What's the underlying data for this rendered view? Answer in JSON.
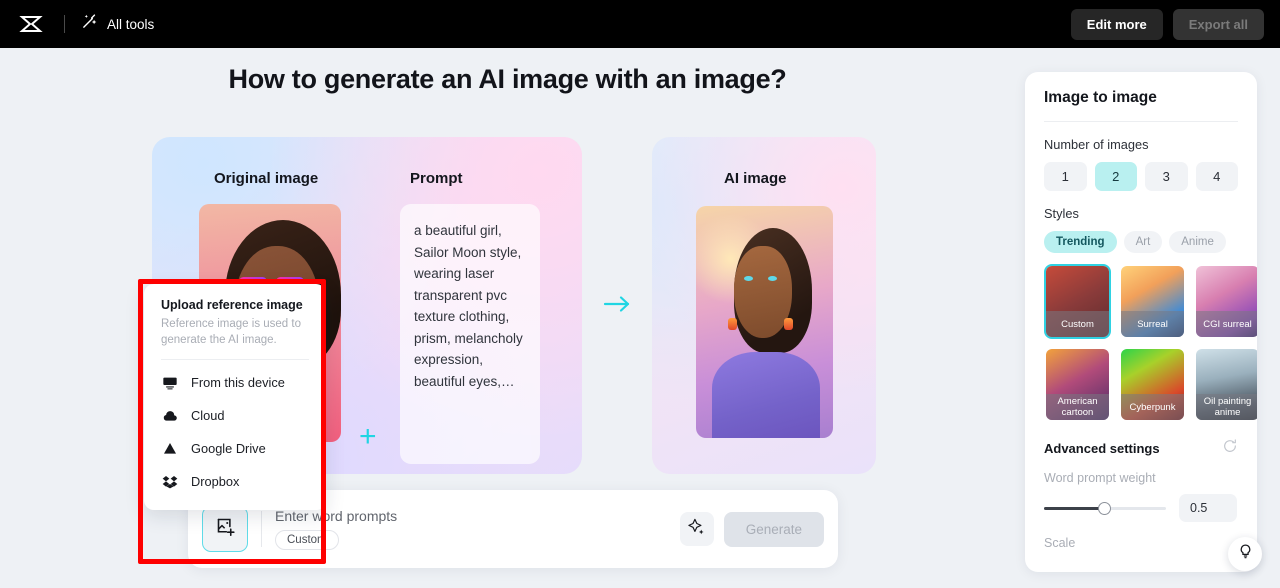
{
  "topbar": {
    "logo_icon": "capcut-logo-icon",
    "alltools_icon": "magic-wand-icon",
    "alltools_label": "All tools",
    "edit_more_label": "Edit more",
    "export_all_label": "Export all"
  },
  "page": {
    "title": "How to generate an AI image with an image?"
  },
  "showcase": {
    "original_heading": "Original image",
    "prompt_heading": "Prompt",
    "ai_heading": "AI image",
    "plus_symbol": "+",
    "arrow_icon": "arrow-right-icon",
    "prompt_text": "a beautiful girl, Sailor Moon style, wearing laser transparent pvc texture clothing, prism, melancholy expression, beautiful eyes,…",
    "accent_cyan": "#20d5e3"
  },
  "bottom_bar": {
    "upload_icon": "add-image-icon",
    "prompt_placeholder": "Enter word prompts",
    "custom_chip_label": "Custom",
    "sparkle_icon": "sparkle-icon",
    "generate_label": "Generate"
  },
  "upload_menu": {
    "title": "Upload reference image",
    "subtitle": "Reference image is used to generate the AI image.",
    "items": [
      {
        "label": "From this device",
        "icon": "monitor-icon"
      },
      {
        "label": "Cloud",
        "icon": "cloud-icon"
      },
      {
        "label": "Google Drive",
        "icon": "google-drive-icon"
      },
      {
        "label": "Dropbox",
        "icon": "dropbox-icon"
      }
    ]
  },
  "annotation": {
    "color": "#fe0000"
  },
  "sidebar": {
    "title": "Image to image",
    "number_of_images_label": "Number of images",
    "number_options": [
      "1",
      "2",
      "3",
      "4"
    ],
    "number_selected": "2",
    "styles_label": "Styles",
    "style_tabs": [
      "Trending",
      "Art",
      "Anime"
    ],
    "style_tab_selected": "Trending",
    "styles": [
      {
        "label": "Custom",
        "selected": true
      },
      {
        "label": "Surreal",
        "selected": false
      },
      {
        "label": "CGI surreal",
        "selected": false
      },
      {
        "label": "American cartoon",
        "selected": false
      },
      {
        "label": "Cyberpunk",
        "selected": false
      },
      {
        "label": "Oil painting anime",
        "selected": false
      }
    ],
    "advanced_title": "Advanced settings",
    "reset_icon": "reset-icon",
    "word_prompt_weight_label": "Word prompt weight",
    "word_prompt_weight_value": "0.5",
    "scale_label": "Scale",
    "selected_accent": "#b9f0f0",
    "border_accent": "#2fd2e3"
  },
  "fab": {
    "icon": "lightbulb-icon"
  }
}
